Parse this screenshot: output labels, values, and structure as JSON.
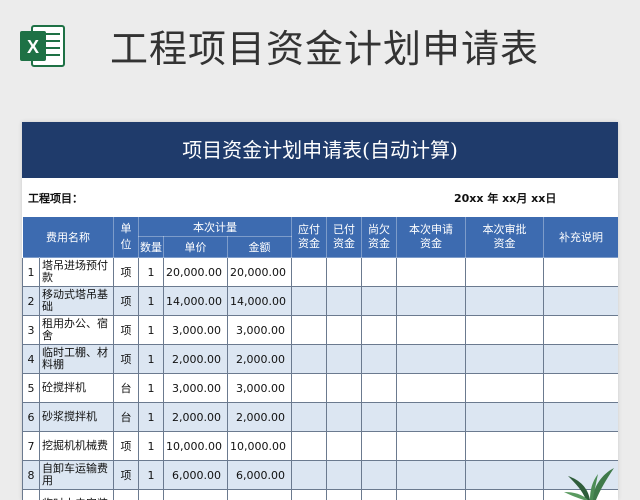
{
  "page": {
    "title": "工程项目资金计划申请表"
  },
  "sheet": {
    "header": "项目资金计划申请表(自动计算)",
    "project_label": "工程项目：",
    "date_text": "20xx 年 xx月 xx日",
    "columns": {
      "fee_name": "费用名称",
      "unit": "单位",
      "plan_group": "本次计量",
      "qty": "数量",
      "price": "单价",
      "amount": "金额",
      "payable": "应付资金",
      "paid": "已付资金",
      "owed": "尚欠资金",
      "apply": "本次申请资金",
      "approve": "本次审批资金",
      "note": "补充说明"
    },
    "rows": [
      {
        "no": "1",
        "name": "塔吊进场预付款",
        "unit": "项",
        "qty": "1",
        "price": "20,000.00",
        "amount": "20,000.00"
      },
      {
        "no": "2",
        "name": "移动式塔吊基础",
        "unit": "项",
        "qty": "1",
        "price": "14,000.00",
        "amount": "14,000.00"
      },
      {
        "no": "3",
        "name": "租用办公、宿舍",
        "unit": "项",
        "qty": "1",
        "price": "3,000.00",
        "amount": "3,000.00"
      },
      {
        "no": "4",
        "name": "临时工棚、材料棚",
        "unit": "项",
        "qty": "1",
        "price": "2,000.00",
        "amount": "2,000.00"
      },
      {
        "no": "5",
        "name": "砼搅拌机",
        "unit": "台",
        "qty": "1",
        "price": "3,000.00",
        "amount": "3,000.00"
      },
      {
        "no": "6",
        "name": "砂浆搅拌机",
        "unit": "台",
        "qty": "1",
        "price": "2,000.00",
        "amount": "2,000.00"
      },
      {
        "no": "7",
        "name": "挖掘机机械费",
        "unit": "项",
        "qty": "1",
        "price": "10,000.00",
        "amount": "10,000.00"
      },
      {
        "no": "8",
        "name": "自卸车运输费用",
        "unit": "项",
        "qty": "1",
        "price": "6,000.00",
        "amount": "6,000.00"
      },
      {
        "no": "",
        "name": "临时水电安装",
        "unit": "",
        "qty": "",
        "price": "",
        "amount": ""
      }
    ]
  },
  "colors": {
    "header_bg": "#1f3b6b",
    "col_header_bg": "#3d6bb0",
    "alt_row": "#dce6f2",
    "excel_green": "#1e7145"
  },
  "icons": {
    "app": "excel-icon",
    "decor": "plant"
  }
}
